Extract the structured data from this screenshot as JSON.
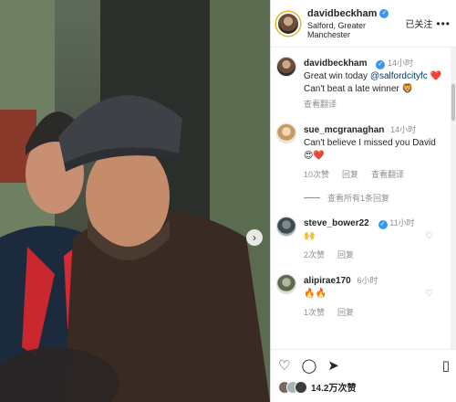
{
  "post": {
    "username": "davidbeckham",
    "location": "Salford, Greater Manchester",
    "follow_label": "已关注",
    "more_label": "•••"
  },
  "caption": {
    "username": "davidbeckham",
    "time": "14小时",
    "text_part1": "Great win today ",
    "mention": "@salfordcityfc",
    "emoji1": "❤️",
    "text_part2": "Can't beat a late winner ",
    "emoji2": "🦁",
    "translate": "查看翻译"
  },
  "comments": [
    {
      "username": "sue_mcgranaghan",
      "time": "14小时",
      "text": "Can't believe I missed you David 😍❤️",
      "likes": "10次赞",
      "reply": "回复",
      "translate": "查看翻译",
      "view_replies": "查看所有1条回复"
    },
    {
      "username": "steve_bower22",
      "time": "11小时",
      "text": "🙌",
      "likes": "2次赞",
      "reply": "回复"
    },
    {
      "username": "alipirae170",
      "time": "6小时",
      "text": "🔥🔥",
      "likes": "1次赞",
      "reply": "回复"
    }
  ],
  "footer": {
    "likes": "14.2万次赞"
  },
  "icons": {
    "verified": "✓",
    "heart_outline": "♡",
    "comment": "◯",
    "share": "➤",
    "bookmark": "▯",
    "next": "›"
  }
}
